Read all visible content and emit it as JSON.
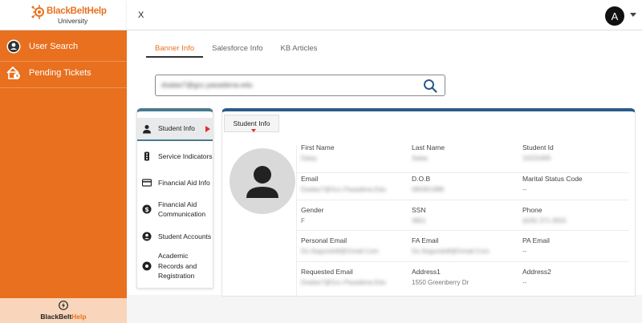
{
  "brand": {
    "name_main": "BlackBelt",
    "name_accent": "Help",
    "subtitle": "University",
    "color": "#e8701f"
  },
  "sidebar": {
    "items": [
      {
        "label": "User Search",
        "icon": "user-search-icon"
      },
      {
        "label": "Pending Tickets",
        "icon": "pending-tickets-icon"
      }
    ],
    "footer": {
      "text_main": "BlackBelt",
      "text_accent": "Help",
      "icon": "lightning-icon"
    }
  },
  "topbar": {
    "close_label": "X",
    "avatar_initial": "A"
  },
  "tabs": [
    {
      "label": "Banner Info",
      "active": true
    },
    {
      "label": "Salesforce Info",
      "active": false
    },
    {
      "label": "KB Articles",
      "active": false
    }
  ],
  "search": {
    "value": "dsalas7@gcc.pasadena.edu"
  },
  "menu": [
    {
      "label": "Student Info",
      "icon": "person-icon",
      "active": true
    },
    {
      "label": "Service Indicators",
      "icon": "traffic-light-icon",
      "active": false
    },
    {
      "label": "Financial Aid Info",
      "icon": "credit-card-icon",
      "active": false
    },
    {
      "label": "Financial Aid Communication",
      "icon": "dollar-icon",
      "active": false
    },
    {
      "label": "Student Accounts",
      "icon": "account-circle-icon",
      "active": false
    },
    {
      "label": "Academic Records and Registration",
      "icon": "record-icon",
      "active": false
    }
  ],
  "student_info": {
    "tab_label": "Student Info",
    "fields": [
      {
        "label": "First Name",
        "value": "Daisy"
      },
      {
        "label": "Last Name",
        "value": "Salas"
      },
      {
        "label": "Student Id",
        "value": "10231665"
      },
      {
        "label": "Email",
        "value": "Dsalas7@Gcc.Pasadena.Edu"
      },
      {
        "label": "D.O.B",
        "value": "08/09/1988"
      },
      {
        "label": "Marital Status Code",
        "value": "--"
      },
      {
        "label": "Gender",
        "value": "F"
      },
      {
        "label": "SSN",
        "value": "3801"
      },
      {
        "label": "Phone",
        "value": "(626) 371-3555"
      },
      {
        "label": "Personal Email",
        "value": "Ds.Segundo8@Gmail.Com"
      },
      {
        "label": "FA Email",
        "value": "Ds.Segundo8@Gmail.Com"
      },
      {
        "label": "PA Email",
        "value": "--"
      },
      {
        "label": "Requested Email",
        "value": "Dsalas7@Gcc.Pasadena.Edu"
      },
      {
        "label": "Address1",
        "value": "1550 Greenberry Dr"
      },
      {
        "label": "Address2",
        "value": "--"
      }
    ]
  }
}
